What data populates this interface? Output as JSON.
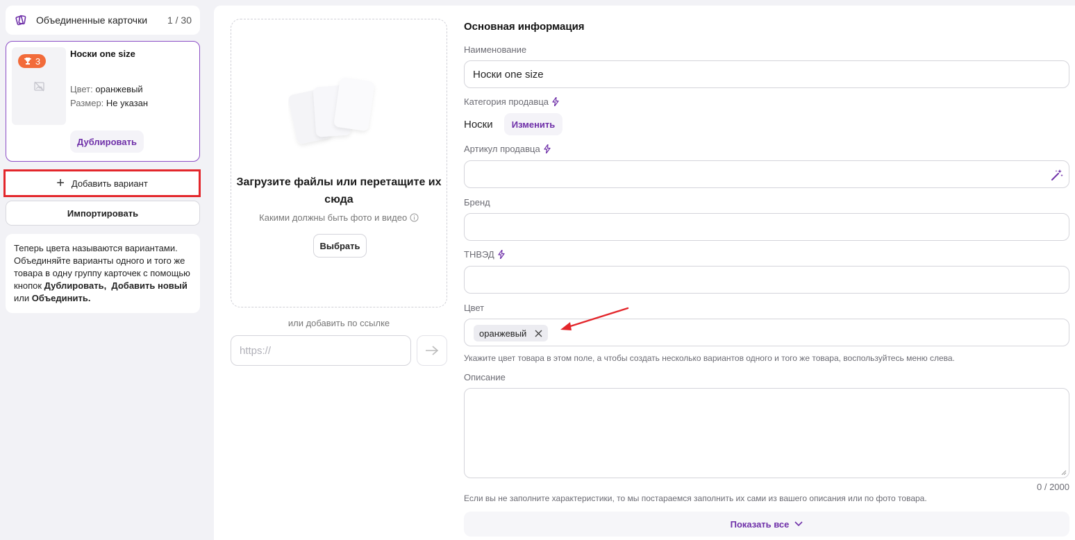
{
  "sidebar": {
    "header": {
      "title": "Объединенные карточки",
      "count": "1 / 30",
      "icon": "cards-icon"
    },
    "card": {
      "badge": "3",
      "name": "Носки one size",
      "color_label": "Цвет:",
      "color_value": "оранжевый",
      "size_label": "Размер:",
      "size_value": "Не указан",
      "duplicate_label": "Дублировать"
    },
    "add_variant_label": "Добавить вариант",
    "import_label": "Импортировать",
    "note": {
      "text1": "Теперь цвета называются вариантами. Объединяйте варианты одного и того же товара в одну группу карточек с помощью кнопок ",
      "dup": "Дублировать,",
      "add": "Добавить новый",
      "or": " или ",
      "merge": "Объединить."
    }
  },
  "upload": {
    "title": "Загрузите файлы или перетащите их сюда",
    "hint": "Какими должны быть фото и видео",
    "choose_label": "Выбрать",
    "or_link": "или добавить по ссылке",
    "url_placeholder": "https://"
  },
  "form": {
    "section_title": "Основная информация",
    "name_label": "Наименование",
    "name_value": "Носки one size",
    "category_label": "Категория продавца",
    "category_value": "Носки",
    "category_change": "Изменить",
    "sku_label": "Артикул продавца",
    "brand_label": "Бренд",
    "tnved_label": "ТНВЭД",
    "color_label": "Цвет",
    "color_chip": "оранжевый",
    "color_helper": "Укажите цвет товара в этом поле, а чтобы создать несколько вариантов одного и того же товара, воспользуйтесь меню слева.",
    "desc_label": "Описание",
    "desc_counter": "0 / 2000",
    "desc_helper": "Если вы не заполните характеристики, то мы постараемся заполнить их сами из вашего описания или по фото товара.",
    "show_all": "Показать все"
  },
  "colors": {
    "accent": "#6e2fa8",
    "badge": "#f26b3a",
    "highlight": "#e3262b"
  }
}
